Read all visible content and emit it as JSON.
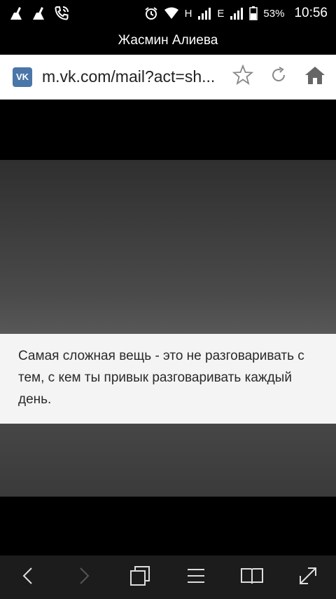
{
  "status_bar": {
    "icons_left": [
      "cleaner-icon",
      "cleaner-icon",
      "phone-call-icon"
    ],
    "network_h": "H",
    "network_e": "E",
    "battery": "53%",
    "time": "10:56"
  },
  "title_bar": {
    "title": "Жасмин Алиева"
  },
  "address_bar": {
    "favicon": "VK",
    "url": "m.vk.com/mail?act=sh..."
  },
  "content": {
    "caption": "Самая сложная вещь - это не разговаривать с тем, с кем ты привык разговаривать каждый день."
  },
  "bottom_nav": {
    "items": [
      "back-icon",
      "forward-icon",
      "tabs-icon",
      "menu-icon",
      "bookmarks-icon",
      "fullscreen-icon"
    ]
  },
  "colors": {
    "vk_brand": "#4a76a8",
    "caption_bg": "#f4f4f4",
    "nav_bg": "#1c1c1c"
  }
}
